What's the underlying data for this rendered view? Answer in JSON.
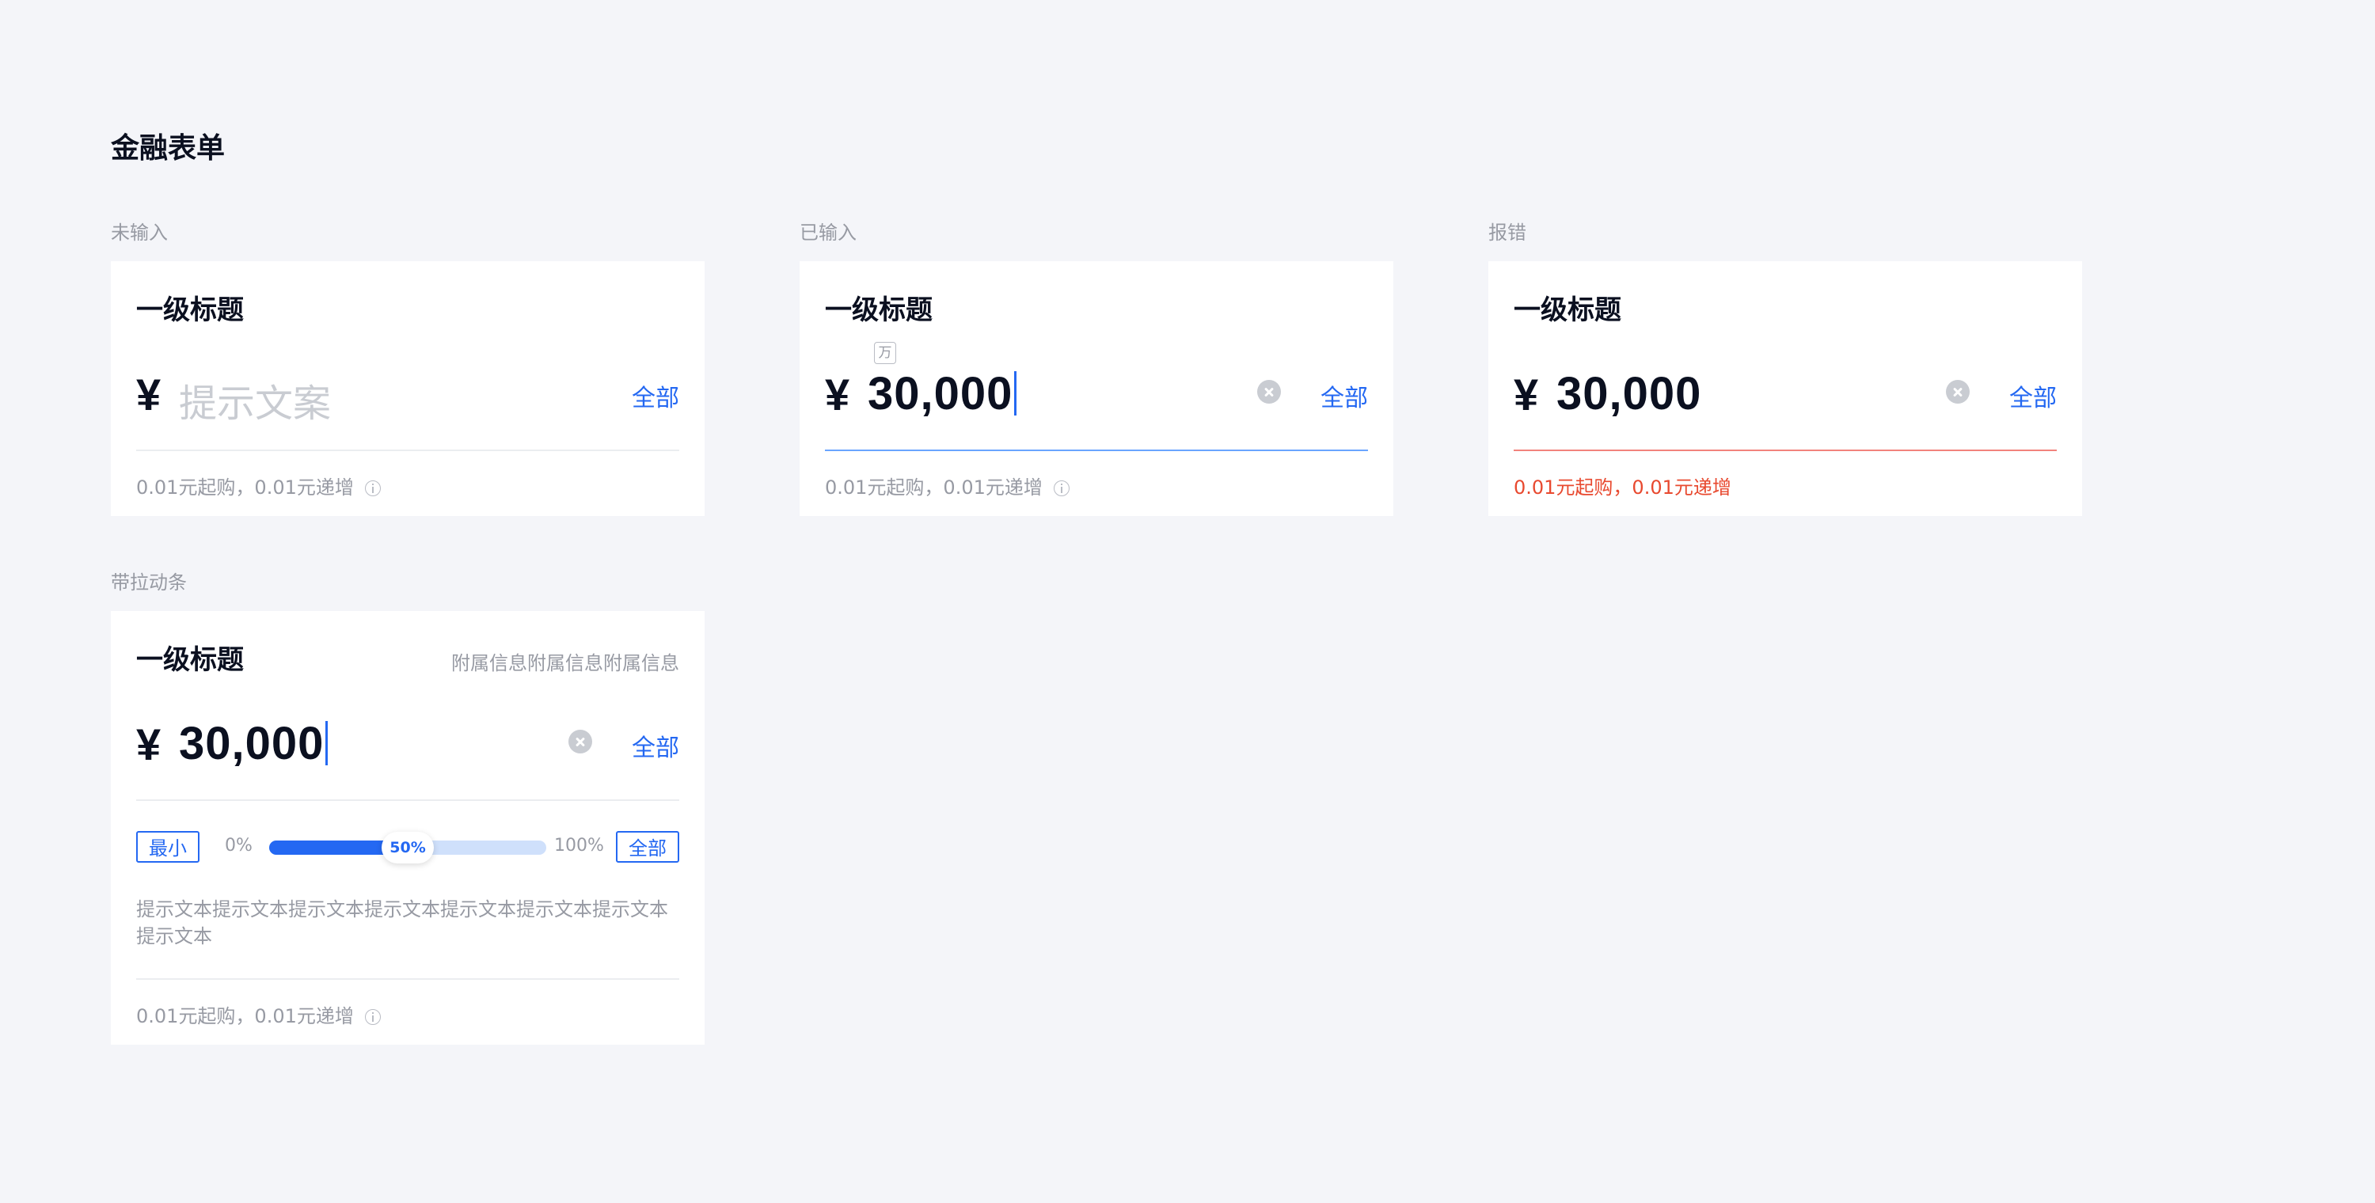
{
  "page": {
    "title": "金融表单"
  },
  "sections": {
    "empty": {
      "label": "未输入",
      "title": "一级标题",
      "currency": "¥",
      "placeholder": "提示文案",
      "all_label": "全部",
      "hint": "0.01元起购，0.01元递增"
    },
    "filled": {
      "label": "已输入",
      "title": "一级标题",
      "currency": "¥",
      "unit_hint": "万",
      "value": "30,000",
      "all_label": "全部",
      "hint": "0.01元起购，0.01元递增"
    },
    "error": {
      "label": "报错",
      "title": "一级标题",
      "currency": "¥",
      "value": "30,000",
      "all_label": "全部",
      "hint": "0.01元起购，0.01元递增"
    },
    "slider": {
      "label": "带拉动条",
      "title": "一级标题",
      "extra": "附属信息附属信息附属信息",
      "currency": "¥",
      "value": "30,000",
      "all_label": "全部",
      "min_chip": "最小",
      "min_pct": "0%",
      "max_pct": "100%",
      "max_chip": "全部",
      "progress": 0.5,
      "progress_label": "50%",
      "description": "提示文本提示文本提示文本提示文本提示文本提示文本提示文本提示文本",
      "hint": "0.01元起购，0.01元递增"
    }
  },
  "colors": {
    "accent": "#2468f2",
    "error": "#e8492f",
    "active_line": "#6aa5ff",
    "muted_text": "#979aa3",
    "background": "#f4f5f9"
  },
  "icons": {
    "clear": "clear-circle-icon",
    "info": "info-circle-icon"
  }
}
